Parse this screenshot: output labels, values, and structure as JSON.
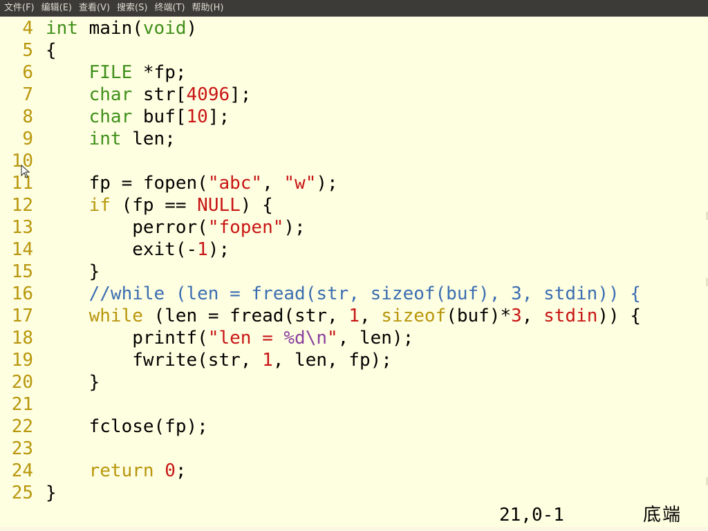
{
  "menubar": {
    "items": [
      "文件(F)",
      "编辑(E)",
      "查看(V)",
      "搜索(S)",
      "终端(T)",
      "帮助(H)"
    ]
  },
  "editor": {
    "lines": [
      {
        "n": "4",
        "tokens": [
          [
            "int",
            "type"
          ],
          [
            " main(",
            "plain"
          ],
          [
            "void",
            "type"
          ],
          [
            ")",
            "plain"
          ]
        ]
      },
      {
        "n": "5",
        "tokens": [
          [
            "{",
            "plain"
          ]
        ]
      },
      {
        "n": "6",
        "tokens": [
          [
            "    ",
            "plain"
          ],
          [
            "FILE",
            "type"
          ],
          [
            " *fp;",
            "plain"
          ]
        ]
      },
      {
        "n": "7",
        "tokens": [
          [
            "    ",
            "plain"
          ],
          [
            "char",
            "type"
          ],
          [
            " str[",
            "plain"
          ],
          [
            "4096",
            "num"
          ],
          [
            "];",
            "plain"
          ]
        ]
      },
      {
        "n": "8",
        "tokens": [
          [
            "    ",
            "plain"
          ],
          [
            "char",
            "type"
          ],
          [
            " buf[",
            "plain"
          ],
          [
            "10",
            "num"
          ],
          [
            "];",
            "plain"
          ]
        ]
      },
      {
        "n": "9",
        "tokens": [
          [
            "    ",
            "plain"
          ],
          [
            "int",
            "type"
          ],
          [
            " len;",
            "plain"
          ]
        ]
      },
      {
        "n": "10",
        "tokens": []
      },
      {
        "n": "11",
        "tokens": [
          [
            "    fp = fopen(",
            "plain"
          ],
          [
            "\"abc\"",
            "str"
          ],
          [
            ", ",
            "plain"
          ],
          [
            "\"w\"",
            "str"
          ],
          [
            ");",
            "plain"
          ]
        ]
      },
      {
        "n": "12",
        "tokens": [
          [
            "    ",
            "plain"
          ],
          [
            "if",
            "kw"
          ],
          [
            " (fp == ",
            "plain"
          ],
          [
            "NULL",
            "const"
          ],
          [
            ") {",
            "plain"
          ]
        ]
      },
      {
        "n": "13",
        "tokens": [
          [
            "        perror(",
            "plain"
          ],
          [
            "\"fopen\"",
            "str"
          ],
          [
            ");",
            "plain"
          ]
        ]
      },
      {
        "n": "14",
        "tokens": [
          [
            "        exit(-",
            "plain"
          ],
          [
            "1",
            "num"
          ],
          [
            ");",
            "plain"
          ]
        ]
      },
      {
        "n": "15",
        "tokens": [
          [
            "    }",
            "plain"
          ]
        ]
      },
      {
        "n": "16",
        "tokens": [
          [
            "    ",
            "plain"
          ],
          [
            "//while (len = fread(str, sizeof(buf), 3, stdin)) {",
            "cmt"
          ]
        ]
      },
      {
        "n": "17",
        "tokens": [
          [
            "    ",
            "plain"
          ],
          [
            "while",
            "kw"
          ],
          [
            " (len = fread(str, ",
            "plain"
          ],
          [
            "1",
            "num"
          ],
          [
            ", ",
            "plain"
          ],
          [
            "sizeof",
            "kw"
          ],
          [
            "(buf)*",
            "plain"
          ],
          [
            "3",
            "num"
          ],
          [
            ", ",
            "plain"
          ],
          [
            "stdin",
            "const"
          ],
          [
            ")) {",
            "plain"
          ]
        ]
      },
      {
        "n": "18",
        "tokens": [
          [
            "        printf(",
            "plain"
          ],
          [
            "\"len = ",
            "str"
          ],
          [
            "%d\\n",
            "esc"
          ],
          [
            "\"",
            "str"
          ],
          [
            ", len);",
            "plain"
          ]
        ]
      },
      {
        "n": "19",
        "tokens": [
          [
            "        fwrite(str, ",
            "plain"
          ],
          [
            "1",
            "num"
          ],
          [
            ", len, fp);",
            "plain"
          ]
        ]
      },
      {
        "n": "20",
        "tokens": [
          [
            "    }",
            "plain"
          ]
        ]
      },
      {
        "n": "21",
        "tokens": []
      },
      {
        "n": "22",
        "tokens": [
          [
            "    fclose(fp);",
            "plain"
          ]
        ]
      },
      {
        "n": "23",
        "tokens": []
      },
      {
        "n": "24",
        "tokens": [
          [
            "    ",
            "plain"
          ],
          [
            "return",
            "kw"
          ],
          [
            " ",
            "plain"
          ],
          [
            "0",
            "num"
          ],
          [
            ";",
            "plain"
          ]
        ]
      },
      {
        "n": "25",
        "tokens": [
          [
            "}",
            "plain"
          ]
        ]
      }
    ]
  },
  "status": {
    "position": "21,0-1",
    "scroll": "底端"
  },
  "colors": {
    "background": "#fefee0",
    "line_number": "#b8960c",
    "type": "#3f8f1a",
    "keyword": "#b8960c",
    "string": "#c81414",
    "comment": "#3a6db2",
    "escape": "#8a3fa0",
    "menubar": "#3c3b37"
  },
  "icons": {
    "mouse_pointer": "mouse-pointer-icon"
  }
}
